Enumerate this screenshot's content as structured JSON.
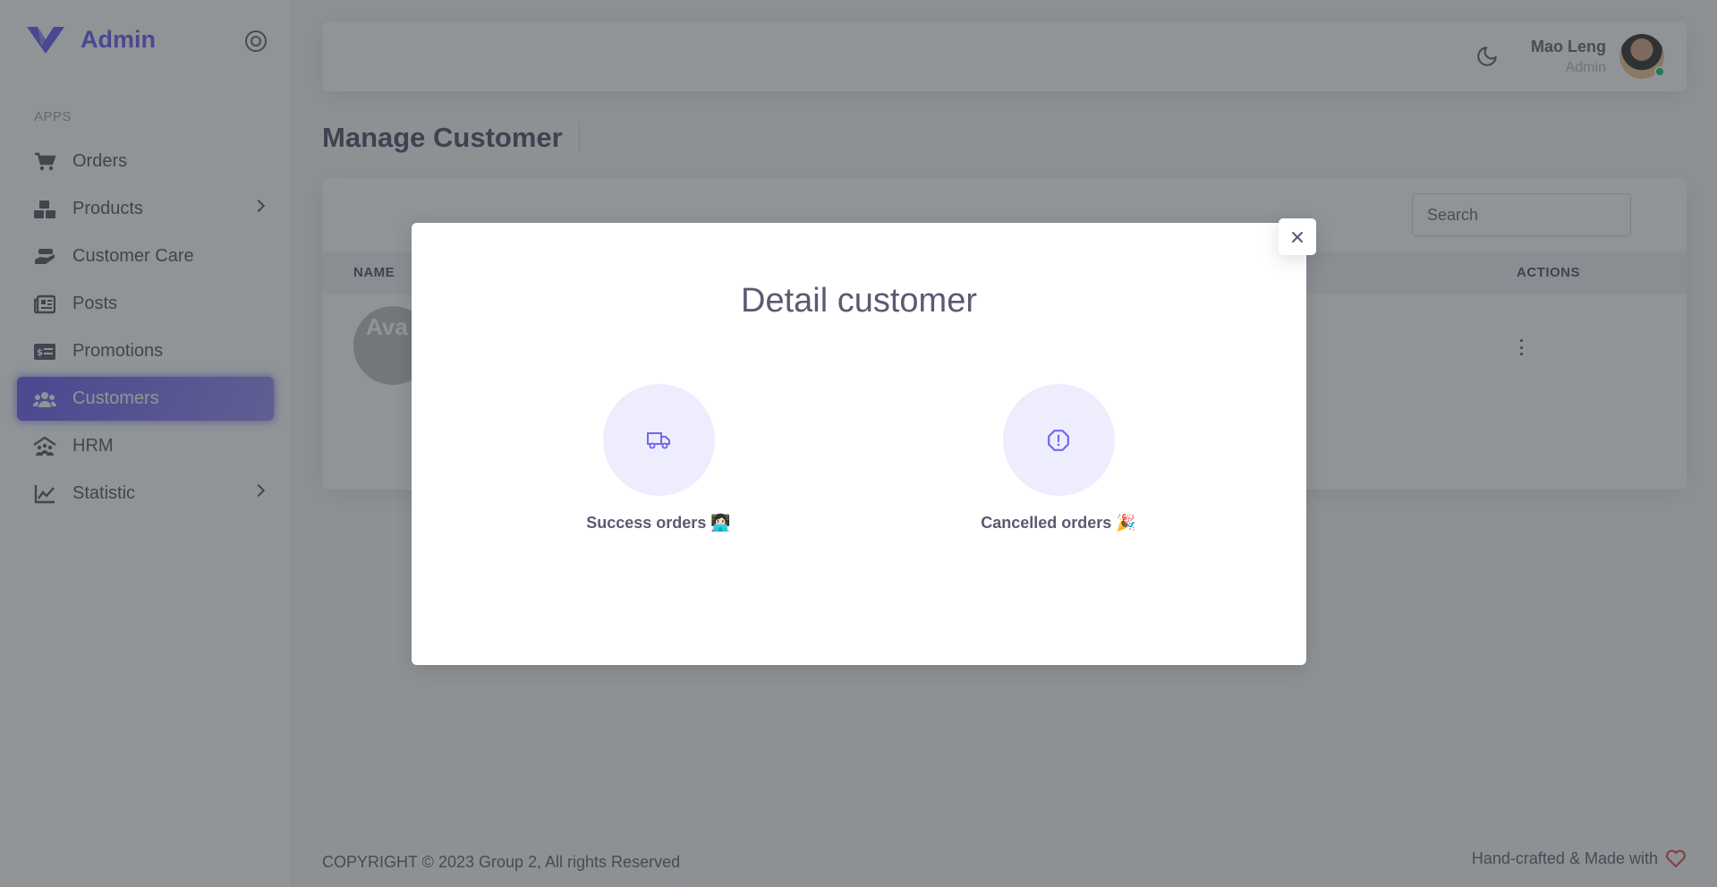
{
  "brand": {
    "name": "Admin",
    "color": "#7367f0"
  },
  "sidebar": {
    "section_label": "APPS",
    "items": [
      {
        "label": "Orders",
        "icon": "cart-icon",
        "has_submenu": false,
        "active": false
      },
      {
        "label": "Products",
        "icon": "boxes-icon",
        "has_submenu": true,
        "active": false
      },
      {
        "label": "Customer Care",
        "icon": "hand-holding-icon",
        "has_submenu": false,
        "active": false
      },
      {
        "label": "Posts",
        "icon": "newspaper-icon",
        "has_submenu": false,
        "active": false
      },
      {
        "label": "Promotions",
        "icon": "money-check-icon",
        "has_submenu": false,
        "active": false
      },
      {
        "label": "Customers",
        "icon": "users-icon",
        "has_submenu": false,
        "active": true
      },
      {
        "label": "HRM",
        "icon": "people-roof-icon",
        "has_submenu": false,
        "active": false
      },
      {
        "label": "Statistic",
        "icon": "chart-line-icon",
        "has_submenu": true,
        "active": false
      }
    ]
  },
  "navbar": {
    "user_name": "Mao Leng",
    "user_role": "Admin",
    "status_color": "#28c76f"
  },
  "page": {
    "title": "Manage Customer",
    "search_placeholder": "Search",
    "table_headers": {
      "name": "NAME",
      "actions": "ACTIONS"
    },
    "row_avatar_alt": "Ava"
  },
  "modal": {
    "title": "Detail customer",
    "stats": [
      {
        "label": "Success orders 👩🏻‍💻",
        "icon": "truck-icon"
      },
      {
        "label": "Cancelled orders 🎉",
        "icon": "alert-octagon-icon"
      }
    ]
  },
  "footer": {
    "copyright": "COPYRIGHT © 2023 Group 2, All rights Reserved",
    "credit": "Hand-crafted & Made with",
    "heart_color": "#ea5455"
  }
}
